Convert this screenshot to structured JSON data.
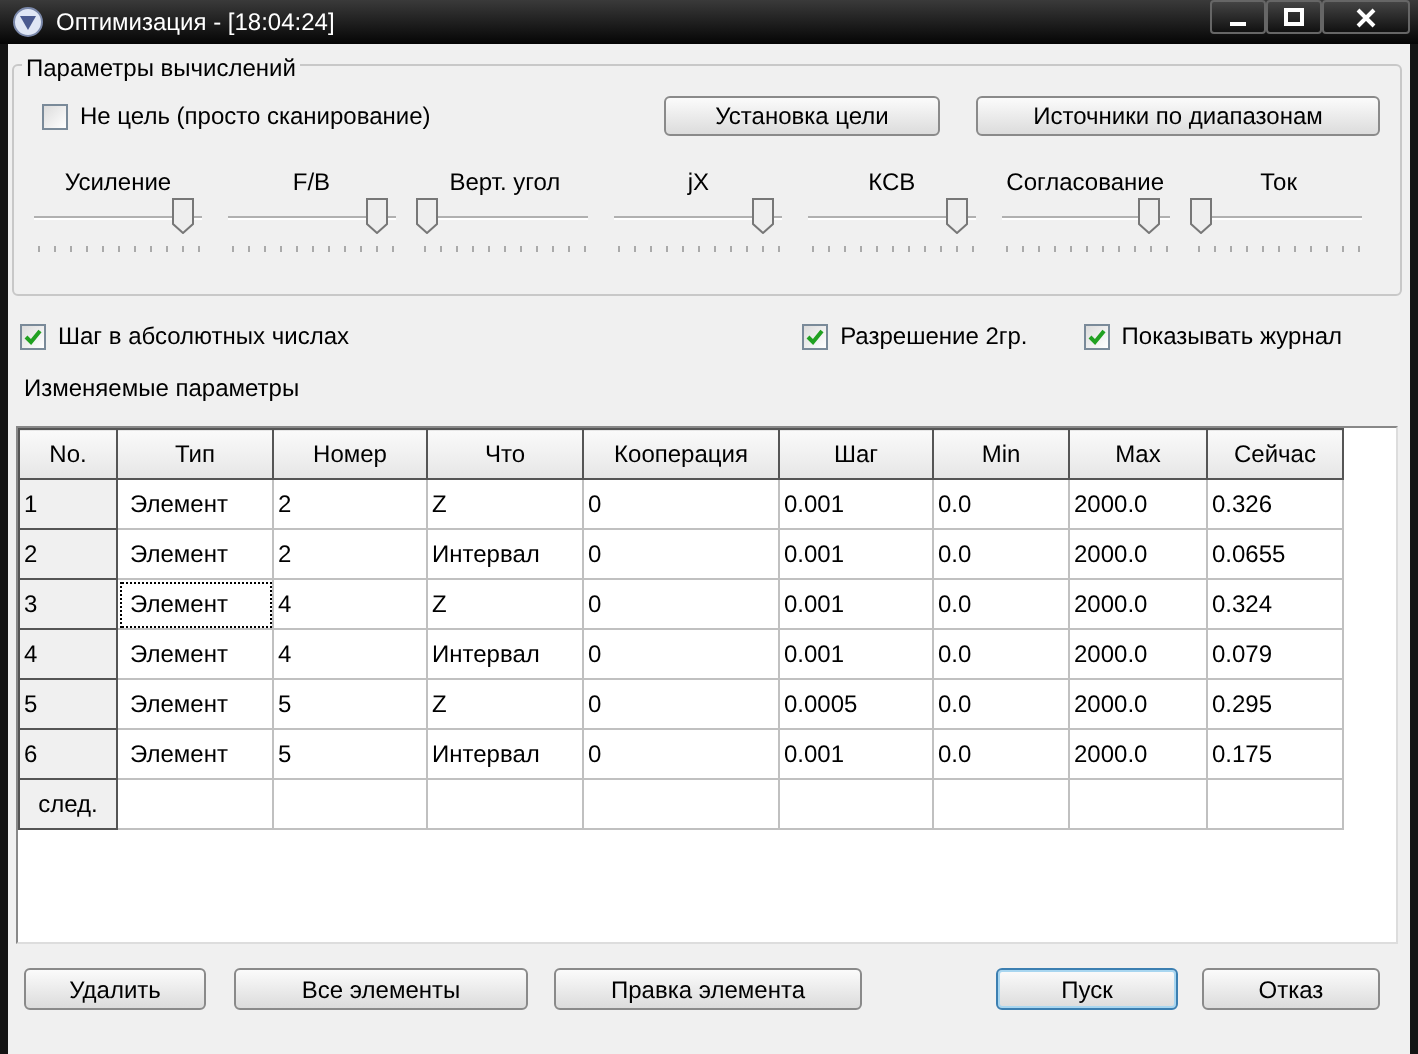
{
  "window": {
    "title": "Оптимизация - [18:04:24]"
  },
  "calc_group": {
    "title": "Параметры вычислений",
    "checkbox": {
      "label": "Не цель (просто сканирование)",
      "checked": false
    },
    "buttons": [
      "Установка цели",
      "Источники по диапазонам"
    ],
    "sliders": [
      {
        "label": "Усиление",
        "level": 0.92
      },
      {
        "label": "F/B",
        "level": 0.92
      },
      {
        "label": "Верт. угол",
        "level": 0
      },
      {
        "label": "jX",
        "level": 0.92
      },
      {
        "label": "КСВ",
        "level": 0.92
      },
      {
        "label": "Согласование",
        "level": 0.92
      },
      {
        "label": "Ток",
        "level": 0
      }
    ]
  },
  "options": [
    {
      "label": "Шаг в абсолютных числах",
      "checked": true
    },
    {
      "label": "Разрешение 2гр.",
      "checked": true
    },
    {
      "label": "Показывать журнал",
      "checked": true
    }
  ],
  "section_label": "Изменяемые параметры",
  "table": {
    "columns": [
      "No.",
      "Тип",
      "Номер",
      "Что",
      "Кооперация",
      "Шаг",
      "Min",
      "Max",
      "Сейчас"
    ],
    "rows": [
      {
        "cells": [
          "1",
          "Элемент",
          "2",
          "Z",
          "0",
          "0.001",
          "0.0",
          "2000.0",
          "0.326"
        ],
        "focused": false
      },
      {
        "cells": [
          "2",
          "Элемент",
          "2",
          "Интервал",
          "0",
          "0.001",
          "0.0",
          "2000.0",
          "0.0655"
        ],
        "focused": false
      },
      {
        "cells": [
          "3",
          "Элемент",
          "4",
          "Z",
          "0",
          "0.001",
          "0.0",
          "2000.0",
          "0.324"
        ],
        "focused": true
      },
      {
        "cells": [
          "4",
          "Элемент",
          "4",
          "Интервал",
          "0",
          "0.001",
          "0.0",
          "2000.0",
          "0.079"
        ],
        "focused": false
      },
      {
        "cells": [
          "5",
          "Элемент",
          "5",
          "Z",
          "0",
          "0.0005",
          "0.0",
          "2000.0",
          "0.295"
        ],
        "focused": false
      },
      {
        "cells": [
          "6",
          "Элемент",
          "5",
          "Интервал",
          "0",
          "0.001",
          "0.0",
          "2000.0",
          "0.175"
        ],
        "focused": false
      }
    ],
    "next_row_label": "след."
  },
  "bottom_buttons": [
    {
      "label": "Удалить",
      "default": false
    },
    {
      "label": "Все элементы",
      "default": false
    },
    {
      "label": "Правка элемента",
      "default": false
    },
    {
      "label": "Пуск",
      "default": true
    },
    {
      "label": "Отказ",
      "default": false
    }
  ]
}
